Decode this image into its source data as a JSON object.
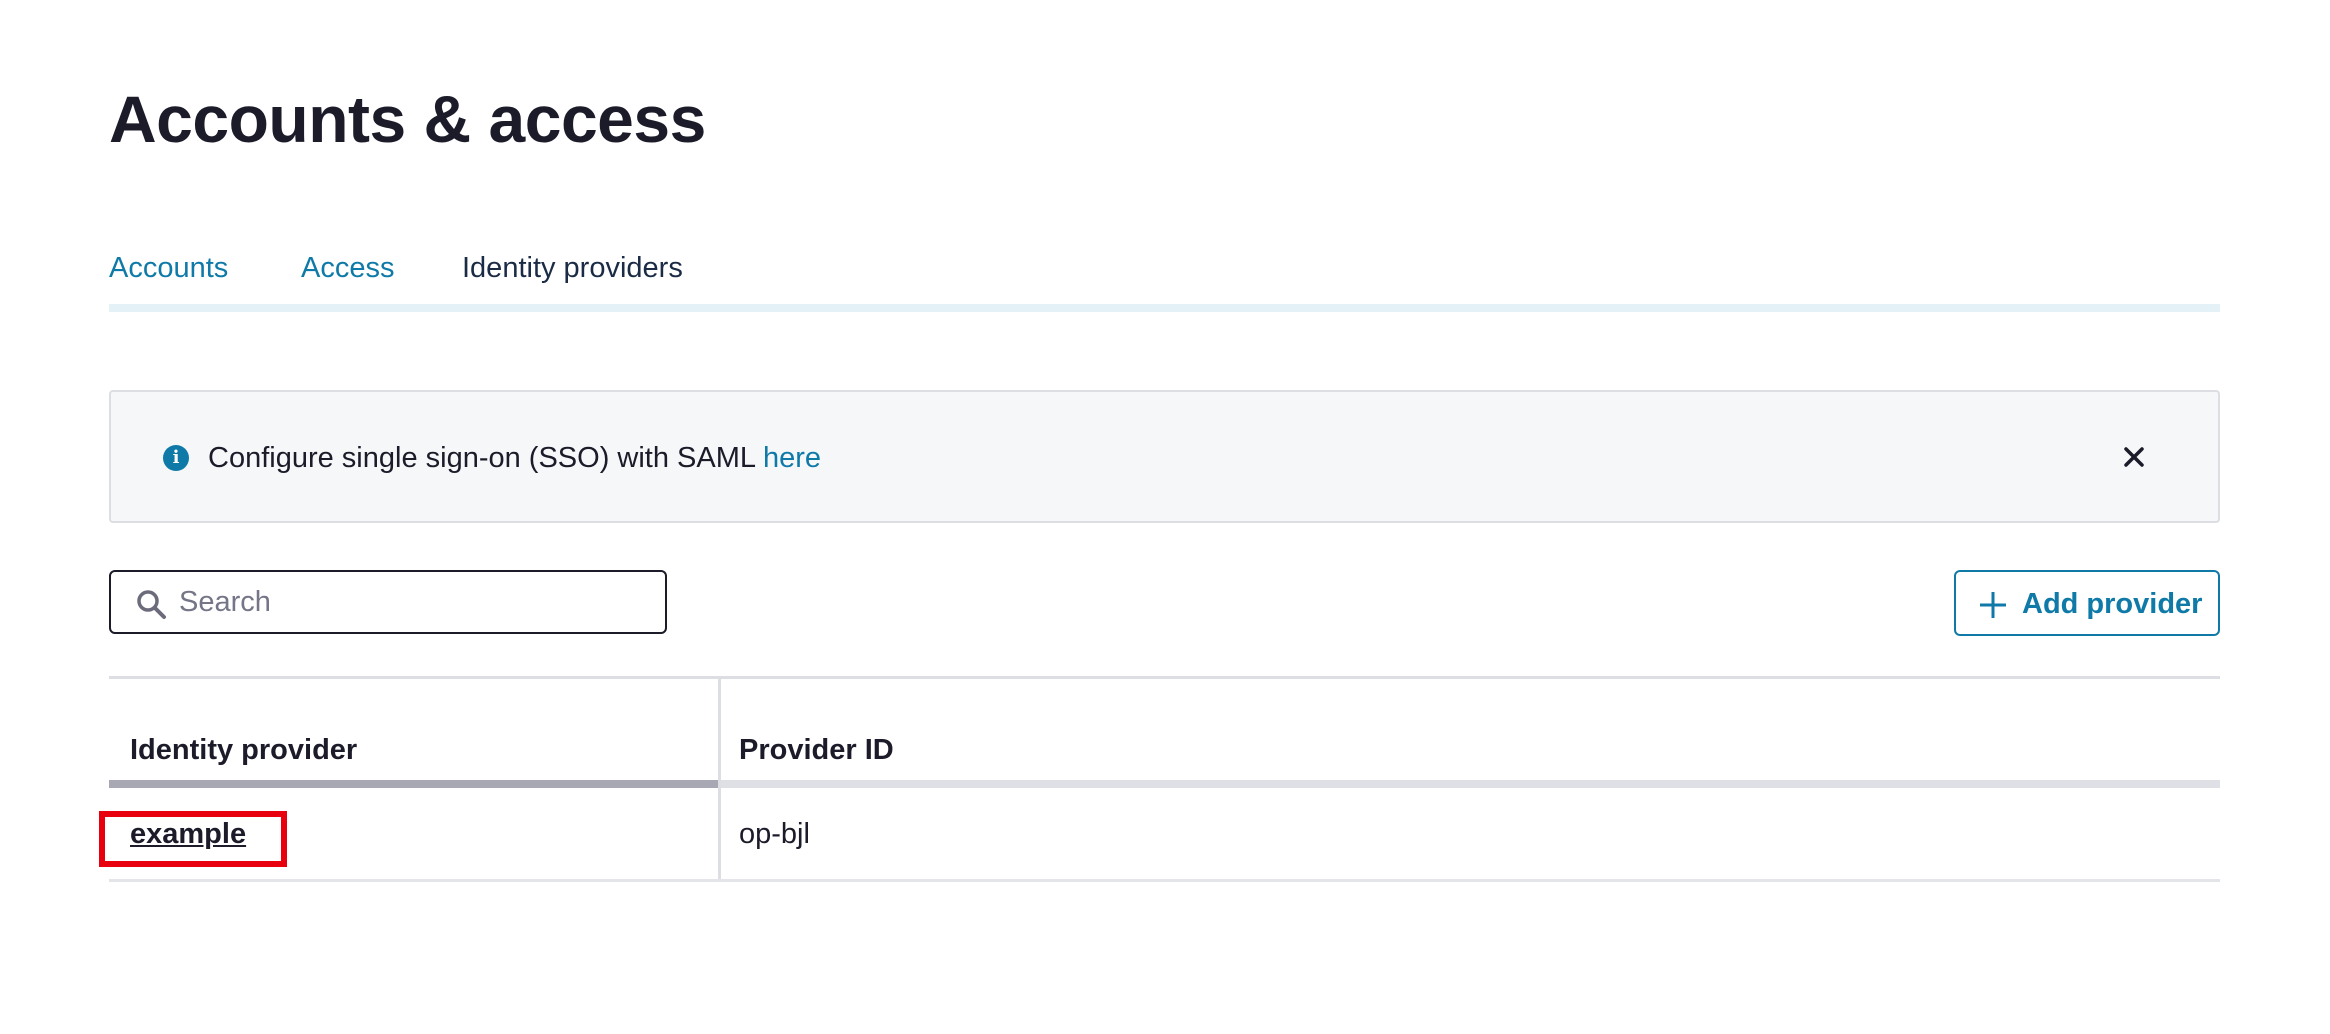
{
  "page": {
    "title": "Accounts & access"
  },
  "tabs": [
    {
      "label": "Accounts",
      "active": false
    },
    {
      "label": "Access",
      "active": false
    },
    {
      "label": "Identity providers",
      "active": true
    }
  ],
  "banner": {
    "text": "Configure single sign-on (SSO) with SAML ",
    "link_text": "here",
    "info_icon": "info-icon",
    "close_icon": "close-icon"
  },
  "search": {
    "placeholder": "Search",
    "value": ""
  },
  "toolbar": {
    "add_label": "Add provider"
  },
  "table": {
    "columns": [
      "Identity provider",
      "Provider ID"
    ],
    "rows": [
      {
        "provider": "example",
        "provider_id": "op-bjl"
      }
    ]
  },
  "colors": {
    "accent": "#0f7aa8",
    "highlight": "#e8000f"
  }
}
